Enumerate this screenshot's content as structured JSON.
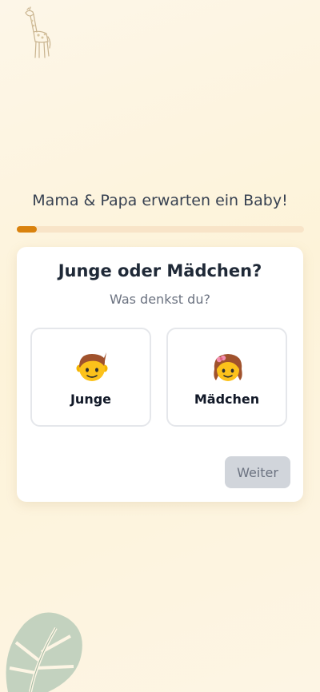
{
  "header": {
    "title": "Mama & Papa erwarten ein Baby!"
  },
  "progress": {
    "value": 0.07,
    "color": "#d9820e"
  },
  "question": {
    "title": "Junge oder Mädchen?",
    "subtitle": "Was denkst du?"
  },
  "options": [
    {
      "label": "Junge",
      "icon": "boy-emoji-icon"
    },
    {
      "label": "Mädchen",
      "icon": "girl-emoji-icon"
    }
  ],
  "actions": {
    "next_label": "Weiter"
  }
}
